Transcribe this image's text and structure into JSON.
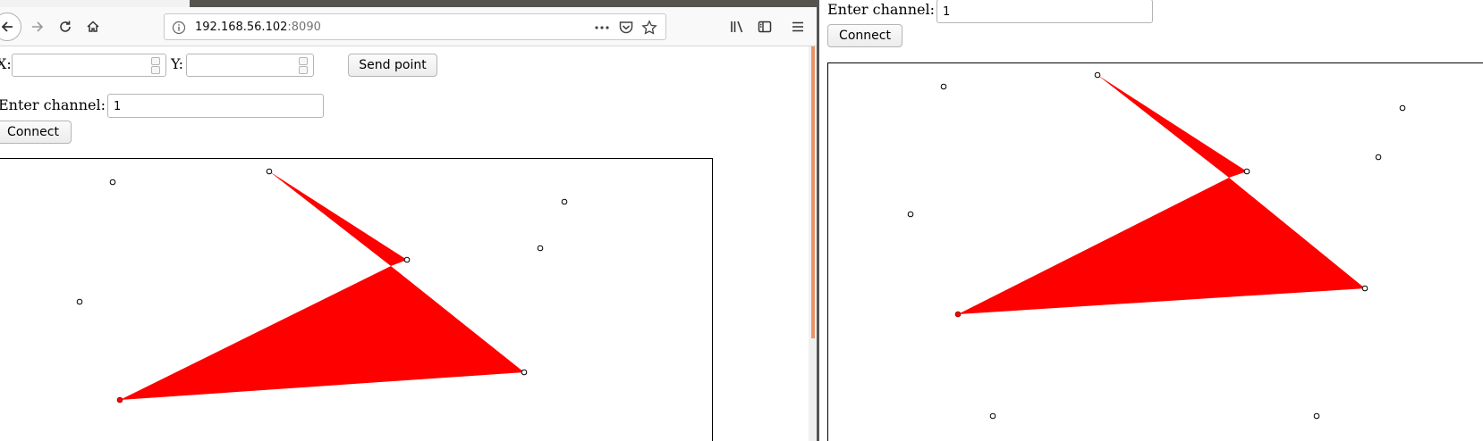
{
  "browser": {
    "url_host": "192.168.56.102",
    "url_port": ":8090"
  },
  "left_app": {
    "x_label": "X:",
    "y_label": "Y:",
    "x_value": "",
    "y_value": "",
    "send_label": "Send point",
    "channel_label": "Enter channel:",
    "channel_value": "1",
    "connect_label": "Connect"
  },
  "right_app": {
    "channel_label": "Enter channel:",
    "channel_value": "1",
    "connect_label": "Connect"
  },
  "colors": {
    "polygon_fill": "#ff0000",
    "point_stroke": "#000000",
    "accent_scroll": "#e8956b"
  },
  "icons": [
    "back-arrow-icon",
    "forward-arrow-icon",
    "reload-icon",
    "home-icon",
    "info-icon",
    "more-icon",
    "pocket-icon",
    "star-icon",
    "library-icon",
    "sidebar-icon",
    "menu-icon"
  ]
}
